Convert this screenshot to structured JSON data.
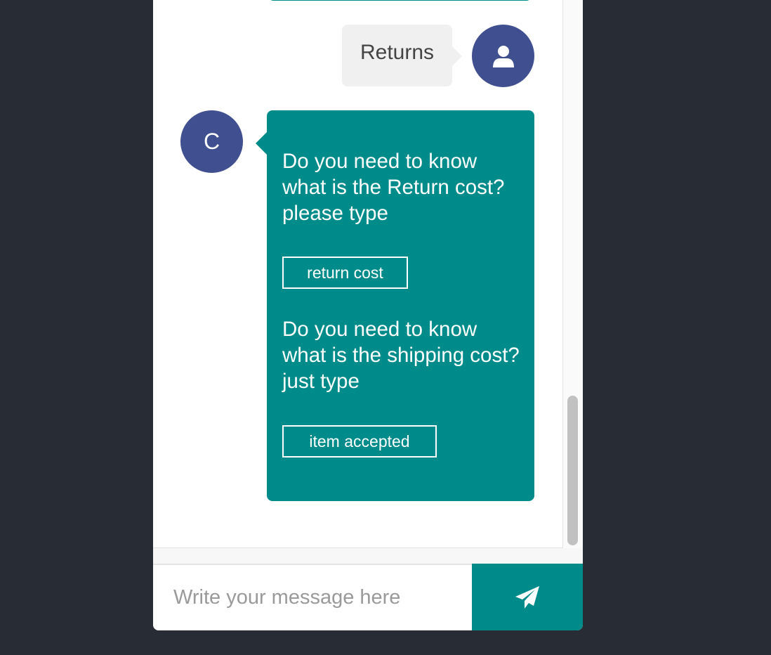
{
  "chat": {
    "messages": [
      {
        "sender": "user",
        "avatar_icon": "user-icon",
        "text": "Returns"
      },
      {
        "sender": "bot",
        "avatar_letter": "C",
        "blocks": [
          {
            "text": "Do you need to know what is the Return cost? please type",
            "option": "return cost"
          },
          {
            "text": "Do you need to know what is the shipping cost? just type",
            "option": "item accepted"
          }
        ]
      }
    ]
  },
  "composer": {
    "placeholder": "Write your message here",
    "send_icon": "paper-plane-icon"
  },
  "colors": {
    "background": "#282c34",
    "accent": "#008b8b",
    "avatar": "#3f4f8f",
    "user_bubble": "#f0f0f0"
  }
}
